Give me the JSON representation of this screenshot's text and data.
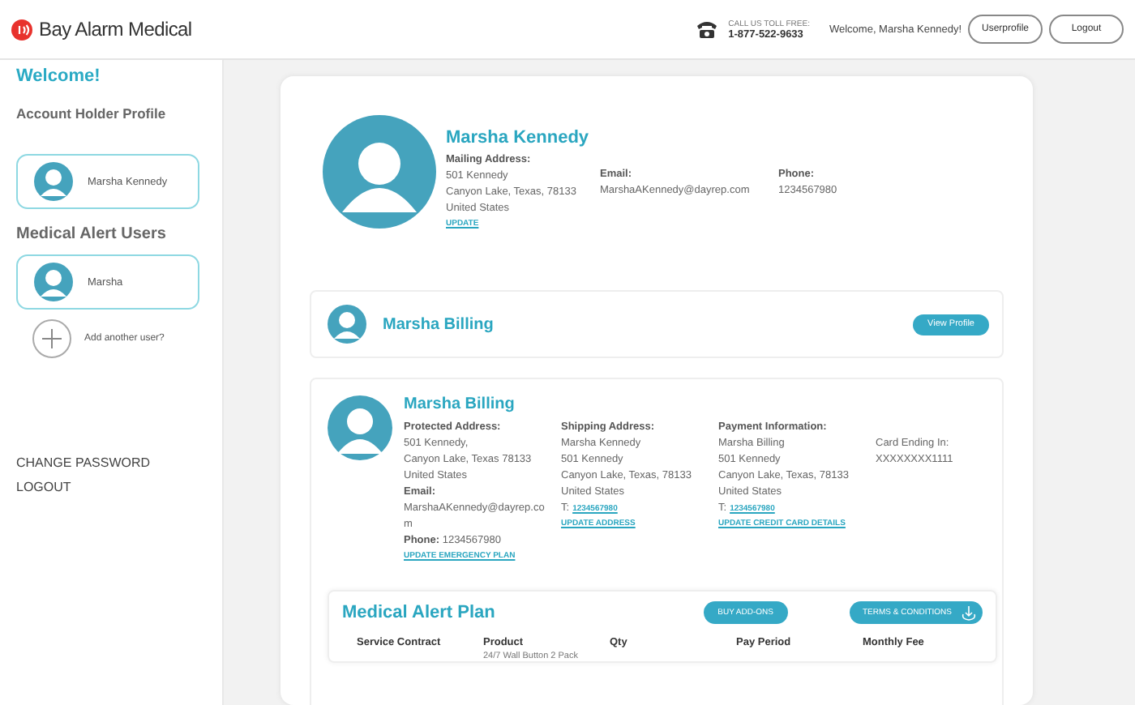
{
  "header": {
    "logo_text": "Bay Alarm Medical",
    "phone_label": "CALL US TOLL FREE:",
    "phone_number": "1-877-522-9633",
    "welcome": "Welcome, Marsha Kennedy!",
    "buttons": [
      "Userprofile",
      "Logout"
    ]
  },
  "sidebar": {
    "welcome": "Welcome!",
    "account_heading": "Account Holder Profile",
    "account_holder": {
      "name": "Marsha Kennedy"
    },
    "users_heading": "Medical Alert Users",
    "users": [
      {
        "name": "Marsha"
      }
    ],
    "add_user": "Add another user?",
    "links": [
      "CHANGE PASSWORD",
      "LOGOUT"
    ]
  },
  "profile": {
    "name": "Marsha Kennedy",
    "mailing_label": "Mailing Address:",
    "mailing_lines": [
      "501 Kennedy",
      "Canyon Lake, Texas, 78133",
      "United States"
    ],
    "update_link": "UPDATE",
    "email_label": "Email:",
    "email": "MarshaAKennedy@dayrep.com",
    "phone_label": "Phone:",
    "phone": "1234567980"
  },
  "user_bar": {
    "name": "Marsha Billing",
    "button": "View Profile"
  },
  "user_detail": {
    "name": "Marsha Billing",
    "columns": [
      [
        {
          "kind": "label",
          "text": "Protected Address:"
        },
        {
          "kind": "text",
          "text": "501 Kennedy,"
        },
        {
          "kind": "text",
          "text": "Canyon Lake, Texas 78133"
        },
        {
          "kind": "text",
          "text": "United States"
        },
        {
          "kind": "label",
          "text": "Email:"
        },
        {
          "kind": "wrap",
          "text": "MarshaAKennedy@dayrep.com"
        },
        {
          "kind": "rich",
          "text": "**Phone:** 1234567980"
        },
        {
          "kind": "link",
          "text": "UPDATE EMERGENCY PLAN"
        }
      ],
      [
        {
          "kind": "label",
          "text": "Shipping Address:"
        },
        {
          "kind": "text",
          "text": "Marsha Kennedy"
        },
        {
          "kind": "text",
          "text": "501 Kennedy"
        },
        {
          "kind": "text",
          "text": "Canyon Lake, Texas, 78133"
        },
        {
          "kind": "text",
          "text": "United States"
        },
        {
          "kind": "tel",
          "prefix": "T:",
          "text": "1234567980"
        },
        {
          "kind": "link",
          "text": "UPDATE ADDRESS"
        }
      ],
      [
        {
          "kind": "label",
          "text": "Payment Information:"
        },
        {
          "kind": "text",
          "text": "Marsha Billing"
        },
        {
          "kind": "text",
          "text": "501 Kennedy"
        },
        {
          "kind": "text",
          "text": "Canyon Lake, Texas, 78133"
        },
        {
          "kind": "text",
          "text": "United States"
        },
        {
          "kind": "tel",
          "prefix": "T:",
          "text": "1234567980"
        },
        {
          "kind": "link",
          "text": "UPDATE CREDIT CARD DETAILS"
        }
      ],
      [
        {
          "kind": "spacer"
        },
        {
          "kind": "text",
          "text": "Card Ending In:"
        },
        {
          "kind": "text",
          "text": "XXXXXXXX1111"
        }
      ]
    ]
  },
  "plan": {
    "title": "Medical Alert Plan",
    "buttons": [
      {
        "label": "BUY ADD-ONS",
        "icon": false
      },
      {
        "label": "TERMS & CONDITIONS",
        "icon": true
      }
    ],
    "columns": [
      "Service Contract",
      "Product",
      "Qty",
      "Pay Period",
      "Monthly Fee"
    ],
    "row": {
      "product": "24/7 Wall Button 2 Pack"
    }
  }
}
